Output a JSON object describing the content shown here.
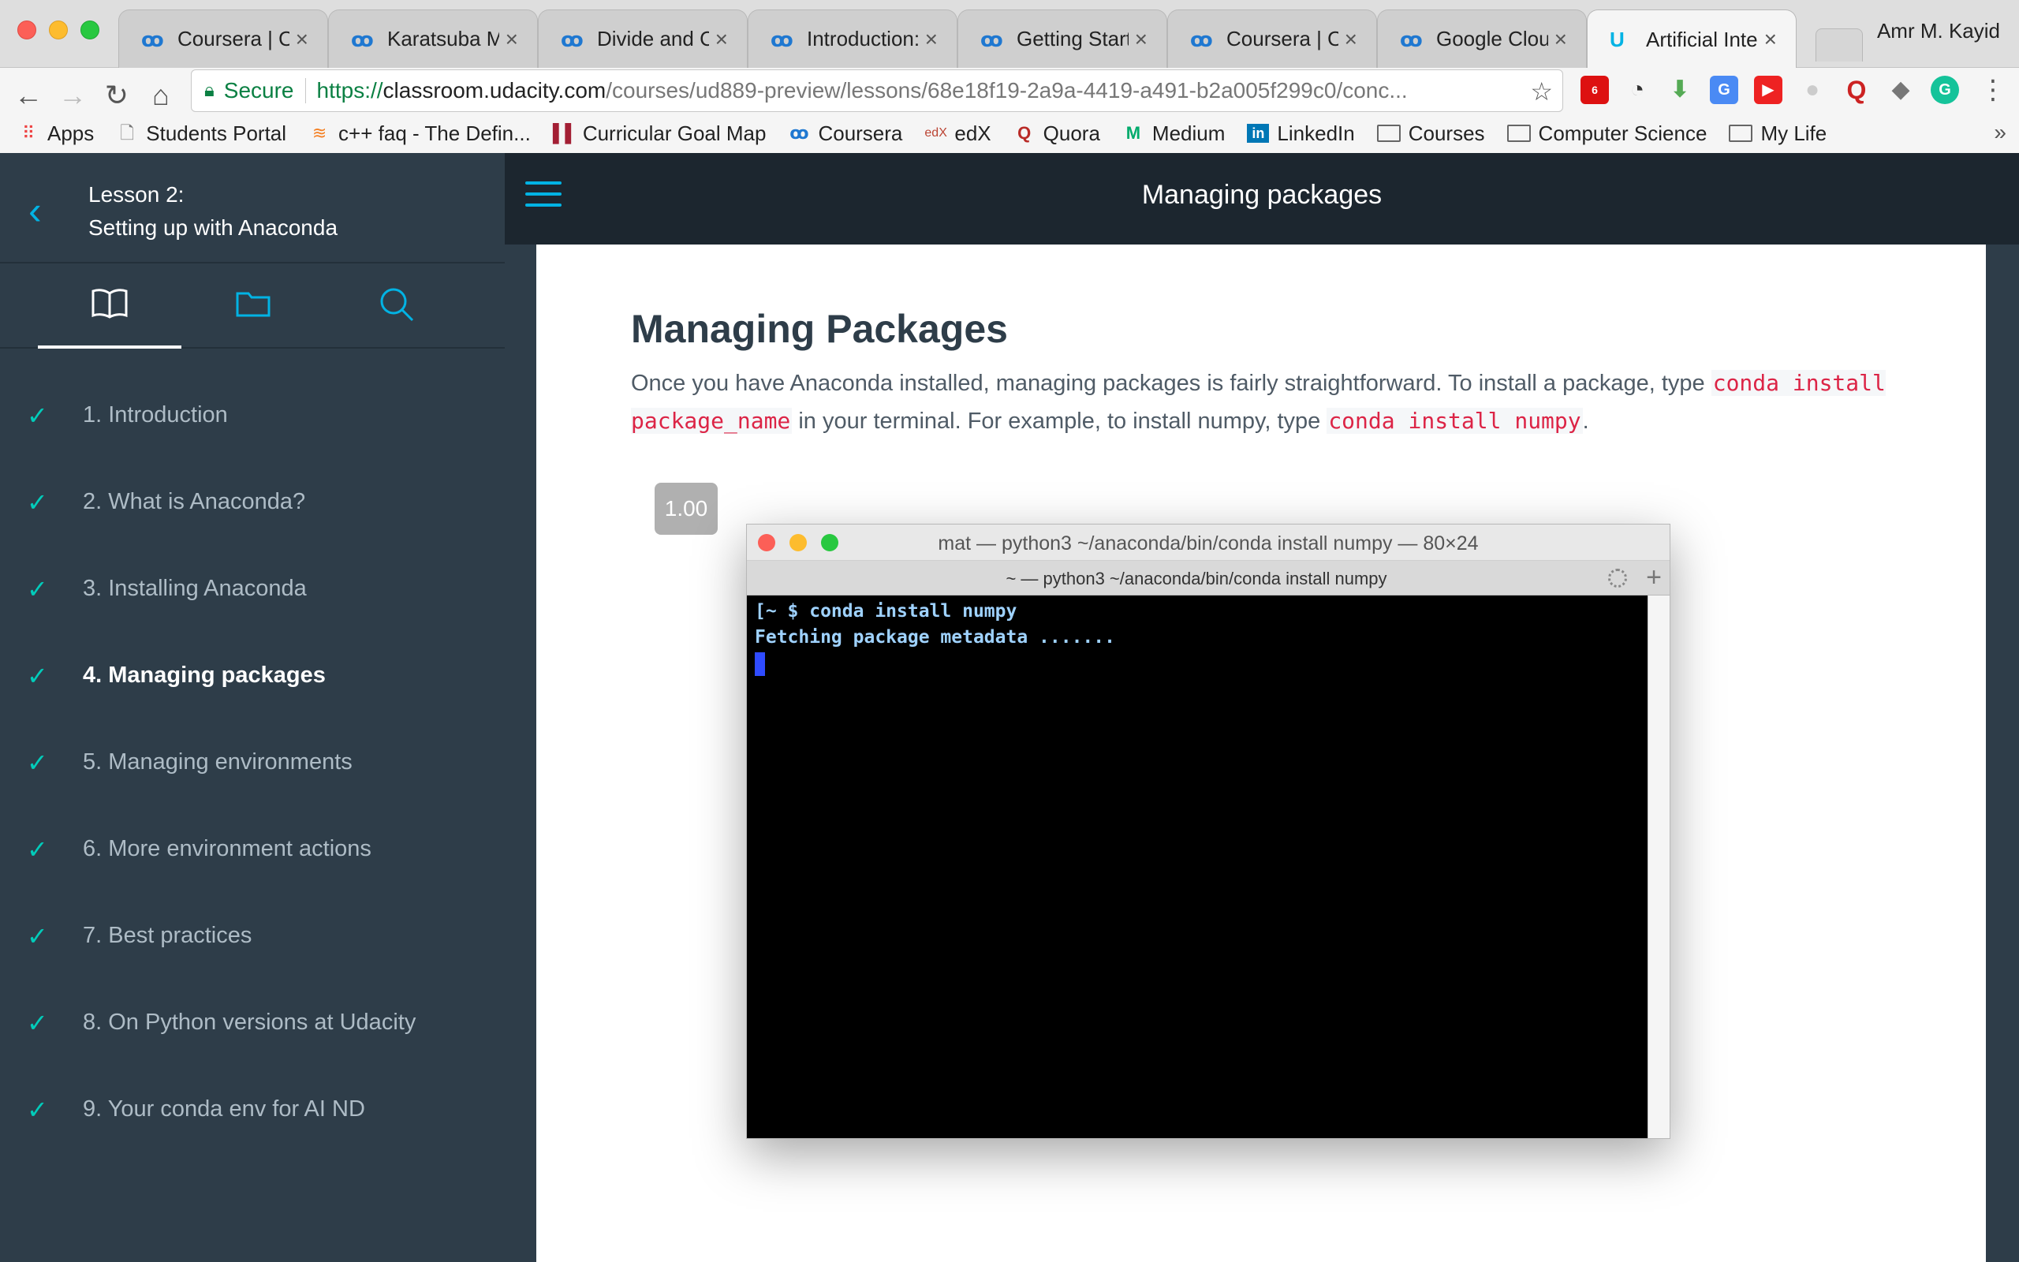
{
  "browser": {
    "tabs": [
      {
        "title": "Coursera | On",
        "icon": "coursera-icon"
      },
      {
        "title": "Karatsuba Mu",
        "icon": "coursera-icon"
      },
      {
        "title": "Divide and Co",
        "icon": "coursera-icon"
      },
      {
        "title": "Introduction: N",
        "icon": "coursera-icon"
      },
      {
        "title": "Getting Starte",
        "icon": "coursera-icon"
      },
      {
        "title": "Coursera | On",
        "icon": "coursera-icon"
      },
      {
        "title": "Google Cloud",
        "icon": "coursera-icon"
      },
      {
        "title": "Artificial Intelli",
        "icon": "udacity-icon",
        "active": true
      }
    ],
    "close_glyph": "×",
    "profile_name": "Amr M. Kayid",
    "secure_label": "Secure",
    "url_scheme": "https://",
    "url_host": "classroom.udacity.com",
    "url_path": "/courses/ud889-preview/lessons/68e18f19-2a9a-4419-a491-b2a005f299c0/conc...",
    "extension_badge": "6",
    "bookmarks": [
      {
        "label": "Apps",
        "icon": "apps-grid-icon"
      },
      {
        "label": "Students Portal",
        "icon": "page-icon"
      },
      {
        "label": "c++ faq - The Defin...",
        "icon": "stackoverflow-icon"
      },
      {
        "label": "Curricular Goal Map",
        "icon": "bars-icon"
      },
      {
        "label": "Coursera",
        "icon": "coursera-icon"
      },
      {
        "label": "edX",
        "icon": "edx-icon"
      },
      {
        "label": "Quora",
        "icon": "quora-icon"
      },
      {
        "label": "Medium",
        "icon": "medium-icon"
      },
      {
        "label": "LinkedIn",
        "icon": "linkedin-icon"
      },
      {
        "label": "Courses",
        "icon": "folder-icon"
      },
      {
        "label": "Computer Science",
        "icon": "folder-icon"
      },
      {
        "label": "My Life",
        "icon": "folder-icon"
      }
    ],
    "bookmarks_overflow": "»"
  },
  "sidebar": {
    "lesson_number": "Lesson 2:",
    "lesson_title": "Setting up with Anaconda",
    "icon_tabs": [
      "book-icon",
      "folder-icon",
      "search-icon"
    ],
    "concepts": [
      {
        "label": "1. Introduction",
        "done": true
      },
      {
        "label": "2. What is Anaconda?",
        "done": true
      },
      {
        "label": "3. Installing Anaconda",
        "done": true
      },
      {
        "label": "4. Managing packages",
        "done": true,
        "current": true
      },
      {
        "label": "5. Managing environments",
        "done": true
      },
      {
        "label": "6. More environment actions",
        "done": true
      },
      {
        "label": "7. Best practices",
        "done": true
      },
      {
        "label": "8. On Python versions at Udacity",
        "done": true
      },
      {
        "label": "9. Your conda env for AI ND",
        "done": true
      }
    ],
    "check_glyph": "✓"
  },
  "main": {
    "page_title": "Managing packages",
    "heading": "Managing Packages",
    "para_1": "Once you have Anaconda installed, managing packages is fairly straightforward. To install a package, type ",
    "code_1": "conda install package_name",
    "para_2": " in your terminal. For example, to install numpy, type ",
    "code_2": "conda install numpy",
    "para_3": ".",
    "playback_speed": "1.00"
  },
  "terminal": {
    "window_title": "mat — python3 ~/anaconda/bin/conda install numpy — 80×24",
    "tab_title": "~ — python3 ~/anaconda/bin/conda install numpy",
    "line_1": "[~ $ conda install numpy",
    "line_2": "Fetching package metadata .......",
    "plus_glyph": "+"
  },
  "colors": {
    "udacity_blue": "#02b3e4",
    "check_teal": "#02ccba",
    "sidebar_bg": "#2e3d49",
    "topbar_bg": "#1c262f",
    "code_red": "#dc2446"
  }
}
